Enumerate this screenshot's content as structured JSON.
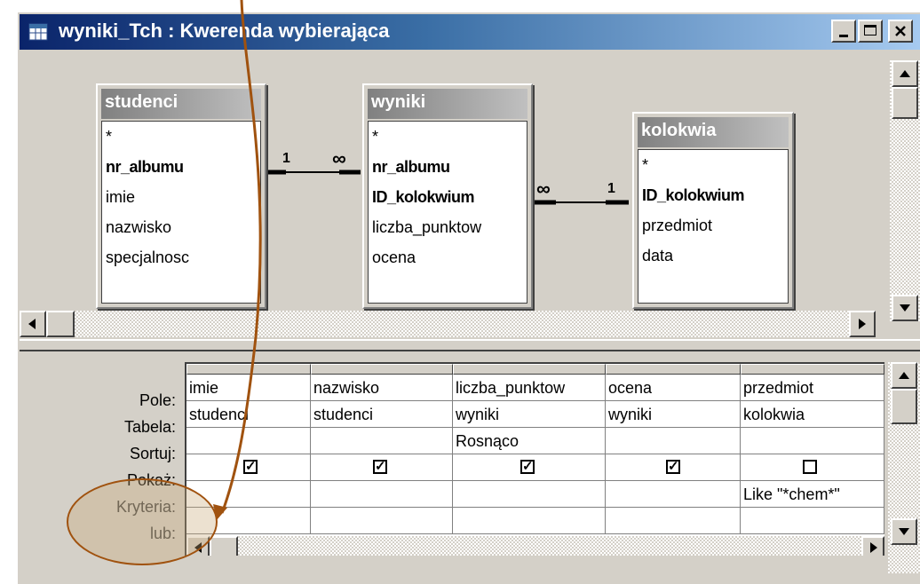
{
  "window": {
    "title": "wyniki_Tch : Kwerenda wybierająca",
    "buttons": [
      "minimize",
      "maximize",
      "close"
    ]
  },
  "tables": [
    {
      "name": "studenci",
      "fields": [
        {
          "label": "*",
          "key": false
        },
        {
          "label": "nr_albumu",
          "key": true
        },
        {
          "label": "imie",
          "key": false
        },
        {
          "label": "nazwisko",
          "key": false
        },
        {
          "label": "specjalnosc",
          "key": false
        }
      ]
    },
    {
      "name": "wyniki",
      "fields": [
        {
          "label": "*",
          "key": false
        },
        {
          "label": "nr_albumu",
          "key": true
        },
        {
          "label": "ID_kolokwium",
          "key": true
        },
        {
          "label": "liczba_punktow",
          "key": false
        },
        {
          "label": "ocena",
          "key": false
        }
      ]
    },
    {
      "name": "kolokwia",
      "fields": [
        {
          "label": "*",
          "key": false
        },
        {
          "label": "ID_kolokwium",
          "key": true
        },
        {
          "label": "przedmiot",
          "key": false
        },
        {
          "label": "data",
          "key": false
        }
      ]
    }
  ],
  "relations": [
    {
      "one": "1",
      "many": "∞"
    },
    {
      "many": "∞",
      "one": "1"
    }
  ],
  "grid": {
    "row_labels": [
      "Pole:",
      "Tabela:",
      "Sortuj:",
      "Pokaż:",
      "Kryteria:",
      "lub:"
    ],
    "columns": [
      {
        "pole": "imie",
        "tabela": "studenci",
        "sortuj": "",
        "pokaz": true,
        "kryteria": "",
        "lub": ""
      },
      {
        "pole": "nazwisko",
        "tabela": "studenci",
        "sortuj": "",
        "pokaz": true,
        "kryteria": "",
        "lub": ""
      },
      {
        "pole": "liczba_punktow",
        "tabela": "wyniki",
        "sortuj": "Rosnąco",
        "pokaz": true,
        "kryteria": "",
        "lub": ""
      },
      {
        "pole": "ocena",
        "tabela": "wyniki",
        "sortuj": "",
        "pokaz": true,
        "kryteria": "",
        "lub": ""
      },
      {
        "pole": "przedmiot",
        "tabela": "kolokwia",
        "sortuj": "",
        "pokaz": false,
        "kryteria": "Like \"*chem*\"",
        "lub": ""
      }
    ]
  },
  "colors": {
    "title_bar_start": "#0a246a",
    "title_bar_end": "#a6caf0",
    "annotation": "#a0520f",
    "annotation_fill": "#e8dcc0"
  },
  "icons": {
    "title": "query-icon",
    "check": "checkmark-icon"
  }
}
